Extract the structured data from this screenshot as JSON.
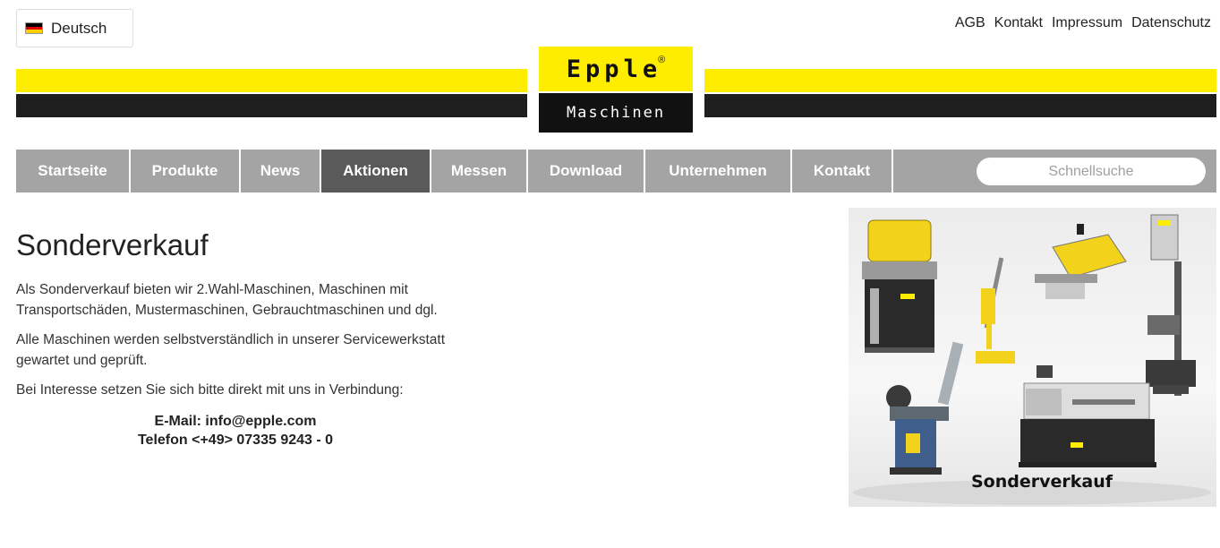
{
  "language": {
    "label": "Deutsch",
    "flag_icon": "germany-flag-icon"
  },
  "top_links": [
    "AGB",
    "Kontakt",
    "Impressum",
    "Datenschutz"
  ],
  "logo": {
    "brand": "Epple",
    "registered": "®",
    "subtitle": "Maschinen"
  },
  "nav": {
    "items": [
      {
        "label": "Startseite",
        "active": false
      },
      {
        "label": "Produkte",
        "active": false
      },
      {
        "label": "News",
        "active": false
      },
      {
        "label": "Aktionen",
        "active": true
      },
      {
        "label": "Messen",
        "active": false
      },
      {
        "label": "Download",
        "active": false
      },
      {
        "label": "Unternehmen",
        "active": false
      },
      {
        "label": "Kontakt",
        "active": false
      }
    ],
    "search_placeholder": "Schnellsuche"
  },
  "main": {
    "title": "Sonderverkauf",
    "paragraphs": [
      "Als Sonderverkauf bieten wir 2.Wahl-Maschinen, Maschinen mit Transportschäden, Mustermaschinen, Gebrauchtmaschinen und dgl.",
      "Alle Maschinen werden selbstverständlich in unserer Servicewerkstatt gewartet und geprüft.",
      "Bei Interesse setzen Sie sich bitte direkt mit uns in Verbindung:"
    ],
    "email": "E-Mail: info@epple.com",
    "phone": "Telefon <+49> 07335 9243 - 0"
  },
  "promo": {
    "label": "Sonderverkauf"
  },
  "colors": {
    "brand_yellow": "#ffed00",
    "brand_black": "#1e1e1e",
    "nav_gray": "#a4a4a4",
    "nav_active": "#5a5a5a"
  }
}
